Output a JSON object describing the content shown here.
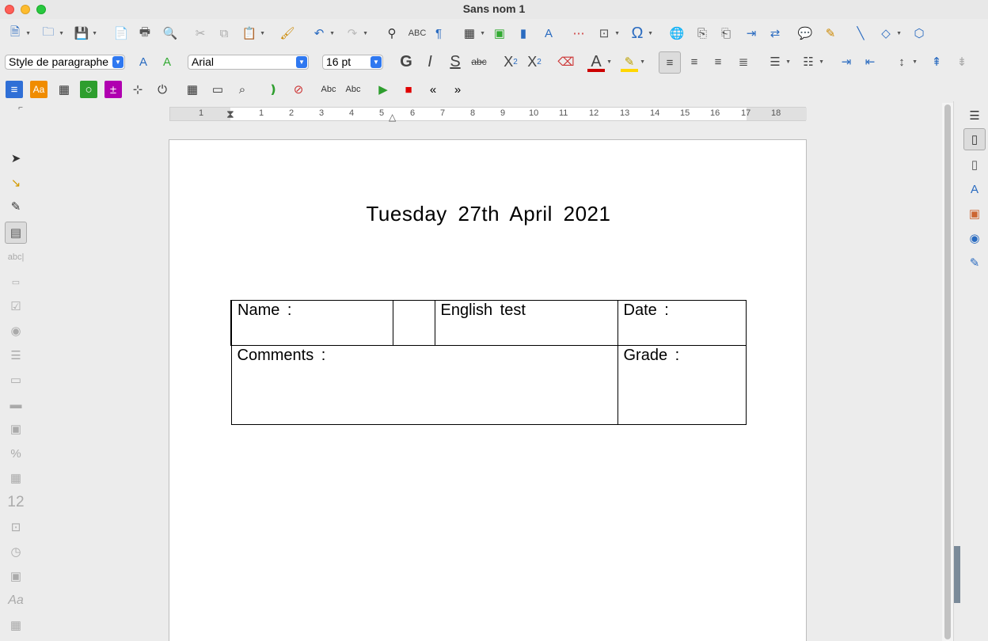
{
  "window": {
    "title": "Sans nom 1"
  },
  "toolbar1": {
    "icons": [
      "new-document-icon",
      "open-folder-icon",
      "save-icon",
      "export-pdf-icon",
      "print-icon",
      "print-preview-icon",
      "cut-icon",
      "copy-icon",
      "paste-icon",
      "clone-formatting-icon",
      "undo-icon",
      "redo-icon",
      "find-replace-icon",
      "spelling-icon",
      "formatting-marks-icon",
      "insert-table-icon",
      "insert-image-icon",
      "insert-chart-icon",
      "insert-textbox-icon",
      "page-break-icon",
      "insert-field-icon",
      "special-character-icon",
      "hyperlink-icon",
      "footnote-icon",
      "endnote-icon",
      "bookmark-icon",
      "cross-reference-icon",
      "comment-icon",
      "track-changes-icon",
      "line-icon",
      "basic-shapes-icon",
      "draw-functions-icon"
    ]
  },
  "toolbar2": {
    "paragraph_style": "Style de paragraphe",
    "font_name": "Arial",
    "font_size": "16 pt",
    "bold_label": "G",
    "italic_label": "I",
    "shadow_label": "S",
    "strike_label": "abc",
    "superscript_label": "X",
    "subscript_label": "X",
    "superscript_mark": "2",
    "subscript_mark": "2",
    "font_color": "#cc0000",
    "highlight_color": "#ffd700"
  },
  "toolbar3": {
    "icons": [
      "controls-icon",
      "text-style-icon",
      "table-control-icon",
      "group-box-icon",
      "spin-button-icon",
      "navigation-icon",
      "plug-icon",
      "date-field-icon",
      "form-field-icon",
      "zoom-icon",
      "autospell-icon",
      "no-autospell-icon",
      "check-spelling-icon",
      "reject-spelling-icon",
      "play-icon",
      "stop-icon",
      "previous-icon",
      "next-icon"
    ],
    "play_color": "#2e9e2e",
    "stop_color": "#e00000"
  },
  "ruler": {
    "labels": [
      "1",
      "1",
      "2",
      "3",
      "4",
      "5",
      "6",
      "7",
      "8",
      "9",
      "10",
      "11",
      "12",
      "13",
      "14",
      "15",
      "16",
      "17",
      "18"
    ]
  },
  "leftbar": {
    "items": [
      "select-icon",
      "design-mode-icon",
      "wizard-icon",
      "form-properties-icon",
      "label-icon",
      "text-box-icon",
      "checkbox-icon",
      "option-button-icon",
      "list-box-icon",
      "combo-box-icon",
      "push-button-icon",
      "image-button-icon",
      "formatted-field-icon",
      "date-field-icon",
      "numeric-field-icon",
      "file-selection-icon",
      "time-field-icon",
      "image-control-icon",
      "font-icon",
      "table-icon"
    ],
    "label_text": "abc|",
    "numeric_text": "12",
    "font_text": "Aa"
  },
  "document": {
    "title": "Tuesday 27th April 2021",
    "table": {
      "name_label": "Name :",
      "test_label": "English test",
      "date_label": "Date :",
      "comments_label": "Comments :",
      "grade_label": "Grade :"
    }
  },
  "rightbar": {
    "items": [
      "sidebar-menu-icon",
      "properties-icon",
      "page-icon",
      "styles-icon",
      "gallery-icon",
      "navigator-icon",
      "manage-changes-icon"
    ]
  }
}
